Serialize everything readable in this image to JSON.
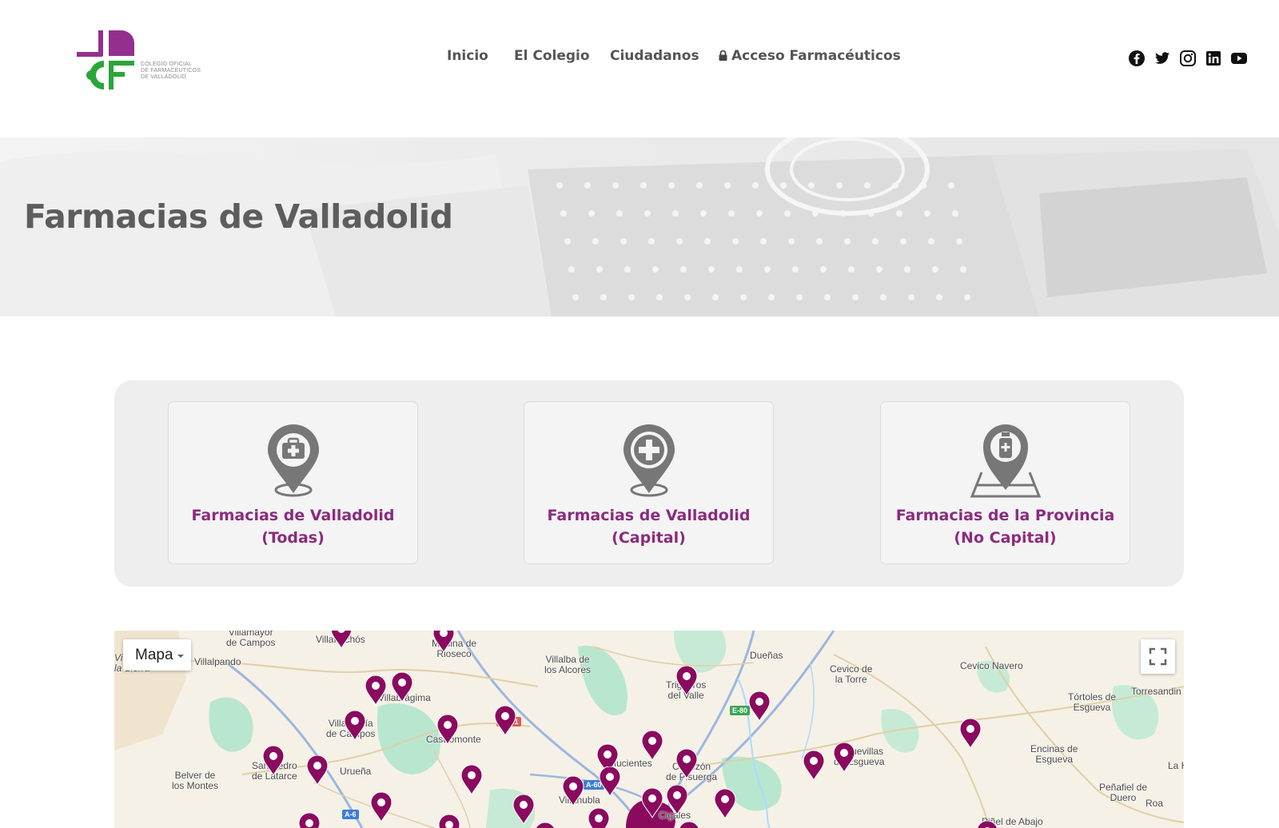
{
  "header": {
    "logo_lines": [
      "COLEGIO OFICIAL",
      "DE FARMACÉUTICOS",
      "DE VALLADOLID"
    ],
    "nav": [
      {
        "label": "Inicio"
      },
      {
        "label": "El Colegio"
      },
      {
        "label": "Ciudadanos"
      },
      {
        "label": "Acceso Farmacéuticos",
        "icon": "lock-icon"
      }
    ],
    "social": [
      "facebook-icon",
      "twitter-icon",
      "instagram-icon",
      "linkedin-icon",
      "youtube-icon"
    ]
  },
  "hero": {
    "title": "Farmacias de Valladolid"
  },
  "categories": [
    {
      "line1": "Farmacias de Valladolid",
      "line2": "(Todas)",
      "icon": "pharmacy-kit-pin-icon"
    },
    {
      "line1": "Farmacias de Valladolid",
      "line2": "(Capital)",
      "icon": "medical-cross-pin-icon"
    },
    {
      "line1": "Farmacias de la Provincia",
      "line2": "(No Capital)",
      "icon": "medicine-bottle-map-pin-icon"
    }
  ],
  "map": {
    "type_label": "Mapa",
    "places": [
      {
        "name": "Villalpando"
      },
      {
        "name": "Villafrechós"
      },
      {
        "name": "Medina de\nRioseco"
      },
      {
        "name": "Villalba de\nlos Alcores"
      },
      {
        "name": "Dueñas"
      },
      {
        "name": "Cevico de\nla Torre"
      },
      {
        "name": "Cevico Navero"
      },
      {
        "name": "Tórtoles de\nEsgueva"
      },
      {
        "name": "Torresandin"
      },
      {
        "name": "Trigueros\ndel Valle"
      },
      {
        "name": "Villabrágima"
      },
      {
        "name": "Villagarcía\nde Campos"
      },
      {
        "name": "Castromonte"
      },
      {
        "name": "San Pedro\nde Latarce"
      },
      {
        "name": "Belver de\nlos Montes"
      },
      {
        "name": "Urueña"
      },
      {
        "name": "Mucientes"
      },
      {
        "name": "Cabezón\nde Pisuerga"
      },
      {
        "name": "Esguevillas\nde Esgueva"
      },
      {
        "name": "Encinas de\nEsgueva"
      },
      {
        "name": "Peñafiel de Duero"
      },
      {
        "name": "Villanubla"
      },
      {
        "name": "Roa"
      },
      {
        "name": "Piñel de Abajo"
      },
      {
        "name": "La H"
      },
      {
        "name": "Villamayor\nde Campos"
      },
      {
        "name": "Cigales"
      },
      {
        "name": "Villas de\nla Sierra"
      }
    ],
    "roads": [
      "N-601",
      "E-80",
      "A-60",
      "A-6"
    ],
    "pin_color": "#8a0a5e"
  }
}
